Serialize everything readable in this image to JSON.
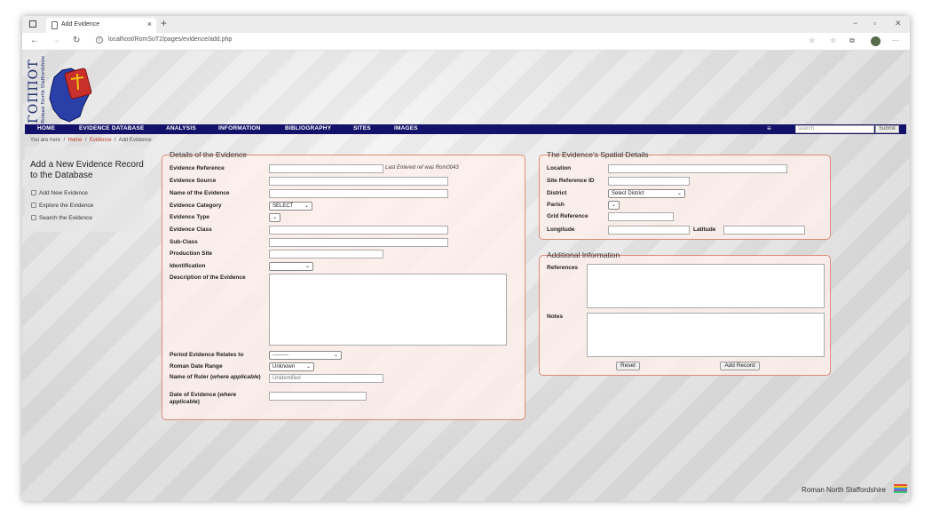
{
  "browser": {
    "tab_title": "Add Evidence",
    "url": "localhost/RomSoT2/pages/evidence/add.php"
  },
  "site": {
    "logo_title": "ΓΟΠΠΟΤ",
    "logo_subtitle": "Roman North Staffordshire"
  },
  "menu": {
    "items": [
      "HOME",
      "EVIDENCE DATABASE",
      "ANALYSIS",
      "INFORMATION",
      "BIBLIOGRAPHY",
      "SITES",
      "IMAGES"
    ],
    "hamburger": "≡",
    "search_placeholder": "search",
    "search_button": "Submit"
  },
  "breadcrumb": {
    "prefix": "You are here",
    "sep": "/",
    "home": "Home",
    "evidence": "Evidence",
    "current": "Add Evidence"
  },
  "sidebar": {
    "heading": "Add a New Evidence Record to the Database",
    "links": [
      "Add New Evidence",
      "Explore the Evidence",
      "Search the Evidence"
    ]
  },
  "details": {
    "legend": "Details of the Evidence",
    "labels": {
      "reference": "Evidence Reference",
      "source": "Evidence Source",
      "name": "Name of the Evidence",
      "category": "Evidence Category",
      "type": "Evidence Type",
      "class": "Evidence Class",
      "subclass": "Sub-Class",
      "production_site": "Production Site",
      "identification": "Identification",
      "description": "Description of the Evidence",
      "period": "Period Evidence Relates to",
      "date_range": "Roman Date Range",
      "ruler_main": "Name of Ruler (",
      "ruler_em": "where applicable",
      "ruler_end": ")",
      "date_main": "Date of Evidence (",
      "date_em": "where applicable",
      "date_end": ")"
    },
    "last_ref_note": "Last Entered ref was Rom0043",
    "category_value": "SELECT",
    "type_value": "",
    "identification_value": "",
    "period_value": "---------",
    "date_range_value": "Unknown",
    "ruler_value": "Unidentified"
  },
  "spatial": {
    "legend": "The Evidence's Spatial Details",
    "labels": {
      "location": "Location",
      "site_ref": "Site Reference ID",
      "district": "District",
      "parish": "Parish",
      "grid_ref": "Grid Reference",
      "longitude": "Longitude",
      "latitude": "Latitude"
    },
    "district_value": "Select District",
    "parish_value": ""
  },
  "additional": {
    "legend": "Additional Information",
    "labels": {
      "references": "References",
      "notes": "Notes"
    },
    "reset": "Reset",
    "add": "Add Record"
  },
  "footer": "Roman North Staffordshire",
  "colors": {
    "menu_bg": "#14116a",
    "fieldset_border": "#e08a7a",
    "link": "#c0392b"
  }
}
